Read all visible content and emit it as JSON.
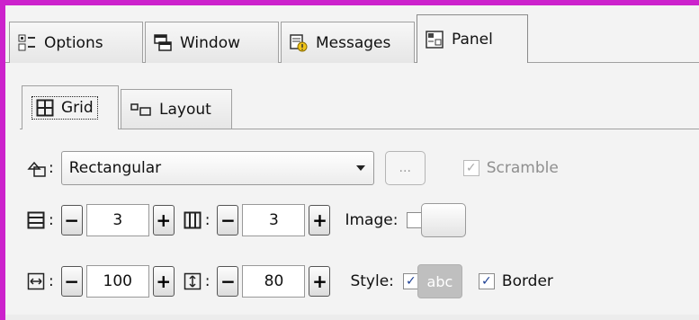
{
  "tabs": [
    {
      "label": "Options",
      "icon": "options-icon",
      "active": false
    },
    {
      "label": "Window",
      "icon": "window-icon",
      "active": false
    },
    {
      "label": "Messages",
      "icon": "messages-icon",
      "active": false
    },
    {
      "label": "Panel",
      "icon": "panel-icon",
      "active": true
    }
  ],
  "subtabs": [
    {
      "label": "Grid",
      "icon": "grid-icon",
      "active": true
    },
    {
      "label": "Layout",
      "icon": "layout-icon",
      "active": false
    }
  ],
  "shape": {
    "label_suffix": ":",
    "value": "Rectangular",
    "more_label": "...",
    "scramble_label": "Scramble",
    "scramble_checked": true,
    "scramble_enabled": false
  },
  "grid": {
    "rows_label": ":",
    "rows_value": "3",
    "cols_label": ":",
    "cols_value": "3",
    "image_label": "Image:",
    "image_checked": false
  },
  "size": {
    "width_label": ":",
    "width_value": "100",
    "height_label": ":",
    "height_value": "80",
    "style_label": "Style:",
    "style_checked": true,
    "style_sample": "abc",
    "border_label": "Border",
    "border_checked": true
  },
  "stepper": {
    "minus": "−",
    "plus": "+"
  },
  "colors": {
    "frame": "#cc22cc",
    "check": "#1c3e92"
  }
}
